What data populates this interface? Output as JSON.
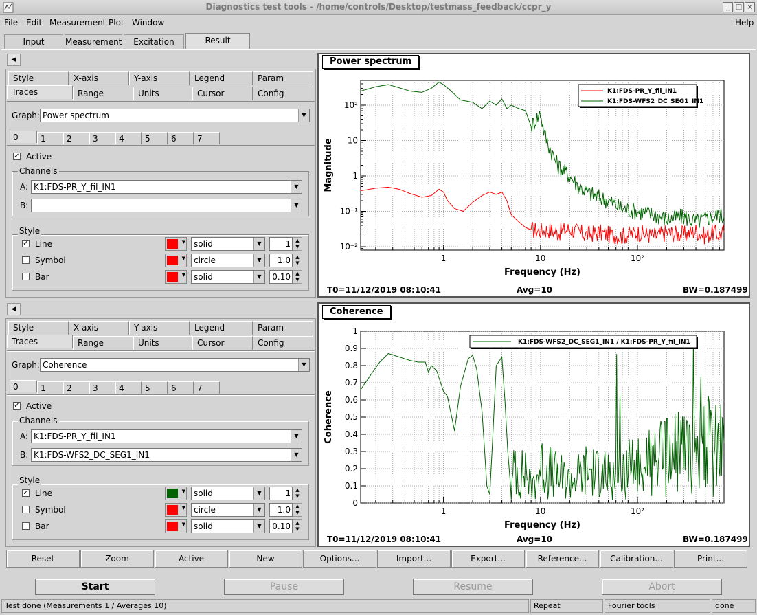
{
  "window": {
    "title": "Diagnostics test tools - /home/controls/Desktop/testmass_feedback/ccpr_y"
  },
  "menu": [
    "File",
    "Edit",
    "Measurement",
    "Plot",
    "Window"
  ],
  "menu_help": "Help",
  "main_tabs": [
    "Input",
    "Measurement",
    "Excitation",
    "Result"
  ],
  "panels": [
    {
      "subtabs_row1": [
        "Style",
        "X-axis",
        "Y-axis",
        "Legend",
        "Param"
      ],
      "subtabs_row2": [
        "Traces",
        "Range",
        "Units",
        "Cursor",
        "Config"
      ],
      "graph_label": "Graph:",
      "graph_value": "Power spectrum",
      "trace_tabs": [
        "0",
        "1",
        "2",
        "3",
        "4",
        "5",
        "6",
        "7"
      ],
      "active_label": "Active",
      "active_checked": "✓",
      "channels_label": "Channels",
      "channel_a_label": "A:",
      "channel_a": "K1:FDS-PR_Y_fil_IN1",
      "channel_b_label": "B:",
      "channel_b": "",
      "style_label": "Style",
      "style_rows": [
        {
          "label": "Line",
          "checked": "✓",
          "color": "#ff0000",
          "style": "solid",
          "value": "1"
        },
        {
          "label": "Symbol",
          "checked": "",
          "color": "#ff0000",
          "style": "circle",
          "value": "1.0"
        },
        {
          "label": "Bar",
          "checked": "",
          "color": "#ff0000",
          "style": "solid",
          "value": "0.10"
        }
      ]
    },
    {
      "subtabs_row1": [
        "Style",
        "X-axis",
        "Y-axis",
        "Legend",
        "Param"
      ],
      "subtabs_row2": [
        "Traces",
        "Range",
        "Units",
        "Cursor",
        "Config"
      ],
      "graph_label": "Graph:",
      "graph_value": "Coherence",
      "trace_tabs": [
        "0",
        "1",
        "2",
        "3",
        "4",
        "5",
        "6",
        "7"
      ],
      "active_label": "Active",
      "active_checked": "✓",
      "channels_label": "Channels",
      "channel_a_label": "A:",
      "channel_a": "K1:FDS-PR_Y_fil_IN1",
      "channel_b_label": "B:",
      "channel_b": "K1:FDS-WFS2_DC_SEG1_IN1",
      "style_label": "Style",
      "style_rows": [
        {
          "label": "Line",
          "checked": "✓",
          "color": "#006400",
          "style": "solid",
          "value": "1"
        },
        {
          "label": "Symbol",
          "checked": "",
          "color": "#ff0000",
          "style": "circle",
          "value": "1.0"
        },
        {
          "label": "Bar",
          "checked": "",
          "color": "#ff0000",
          "style": "solid",
          "value": "0.10"
        }
      ]
    }
  ],
  "plots": [
    {
      "title": "Power spectrum",
      "t0": "T0=11/12/2019 08:10:41",
      "avg": "Avg=10",
      "bw": "BW=0.187499"
    },
    {
      "title": "Coherence",
      "t0": "T0=11/12/2019 08:10:41",
      "avg": "Avg=10",
      "bw": "BW=0.187499"
    }
  ],
  "chart_data": [
    {
      "type": "line",
      "title": "Power spectrum",
      "xlabel": "Frequency (Hz)",
      "ylabel": "Magnitude",
      "xscale": "log",
      "yscale": "log",
      "xlim": [
        0.14,
        780
      ],
      "ylim": [
        0.008,
        500
      ],
      "grid": true,
      "legend": "top-right",
      "x_ticks": [
        "1",
        "10",
        "10²"
      ],
      "y_ticks": [
        "10⁻²",
        "10⁻¹",
        "1",
        "10",
        "10²"
      ],
      "series": [
        {
          "name": "K1:FDS-PR_Y_fil_IN1",
          "color": "#ff0000",
          "x": [
            0.14,
            0.2,
            0.27,
            0.35,
            0.45,
            0.6,
            0.75,
            0.9,
            1.0,
            1.1,
            1.3,
            1.6,
            2.0,
            2.5,
            3.0,
            3.5,
            4.0,
            4.5,
            5.0,
            6.0,
            7.0,
            8.0,
            10,
            12,
            15,
            20,
            25,
            30,
            40,
            50,
            70,
            100,
            150,
            200,
            300,
            400,
            500,
            600,
            700,
            780
          ],
          "y": [
            0.38,
            0.45,
            0.48,
            0.42,
            0.32,
            0.25,
            0.28,
            0.42,
            0.35,
            0.2,
            0.12,
            0.1,
            0.18,
            0.28,
            0.35,
            0.3,
            0.35,
            0.2,
            0.08,
            0.05,
            0.035,
            0.03,
            0.028,
            0.03,
            0.025,
            0.032,
            0.025,
            0.022,
            0.025,
            0.022,
            0.02,
            0.025,
            0.02,
            0.025,
            0.022,
            0.028,
            0.02,
            0.025,
            0.022,
            0.025
          ]
        },
        {
          "name": "K1:FDS-WFS2_DC_SEG1_IN1",
          "color": "#006400",
          "x": [
            0.14,
            0.2,
            0.27,
            0.35,
            0.45,
            0.6,
            0.75,
            0.9,
            1.0,
            1.2,
            1.5,
            2.0,
            2.5,
            3.0,
            3.5,
            4.0,
            4.5,
            5.0,
            6.0,
            7.0,
            8.0,
            9.0,
            10,
            11,
            12,
            15,
            20,
            25,
            30,
            40,
            50,
            70,
            100,
            150,
            200,
            300,
            400,
            500,
            600,
            700,
            780
          ],
          "y": [
            250,
            330,
            380,
            310,
            250,
            230,
            300,
            450,
            380,
            250,
            140,
            120,
            80,
            130,
            100,
            150,
            80,
            100,
            80,
            70,
            25,
            40,
            60,
            15,
            8,
            2,
            1.0,
            0.5,
            0.35,
            0.25,
            0.2,
            0.12,
            0.1,
            0.08,
            0.06,
            0.07,
            0.05,
            0.06,
            0.07,
            0.08,
            0.07
          ]
        }
      ]
    },
    {
      "type": "line",
      "title": "Coherence",
      "xlabel": "Frequency (Hz)",
      "ylabel": "Coherence",
      "xscale": "log",
      "xlim": [
        0.14,
        780
      ],
      "ylim": [
        0,
        1
      ],
      "grid": true,
      "legend": "top-right",
      "x_ticks": [
        "1",
        "10",
        "10²"
      ],
      "y_ticks": [
        "0",
        "0.1",
        "0.2",
        "0.3",
        "0.4",
        "0.5",
        "0.6",
        "0.7",
        "0.8",
        "0.9",
        "1"
      ],
      "series": [
        {
          "name": "K1:FDS-WFS2_DC_SEG1_IN1 / K1:FDS-PR_Y_fil_IN1",
          "color": "#006400",
          "x": [
            0.14,
            0.18,
            0.22,
            0.27,
            0.35,
            0.45,
            0.55,
            0.65,
            0.7,
            0.75,
            0.85,
            1.0,
            1.1,
            1.3,
            1.5,
            1.8,
            2.0,
            2.2,
            2.5,
            2.8,
            3.0,
            3.2,
            3.5,
            4.0,
            4.3,
            4.6,
            5.0,
            5.5,
            6.0,
            7.0,
            8.0,
            10,
            15,
            20,
            30,
            50,
            100,
            200,
            400,
            780
          ],
          "y": [
            0.66,
            0.75,
            0.82,
            0.87,
            0.85,
            0.83,
            0.82,
            0.82,
            0.76,
            0.8,
            0.77,
            0.65,
            0.62,
            0.42,
            0.68,
            0.84,
            0.86,
            0.78,
            0.53,
            0.1,
            0.05,
            0.35,
            0.8,
            0.85,
            0.6,
            0.3,
            0.05,
            0.25,
            0.12,
            0.2,
            0.08,
            0.2,
            0.15,
            0.12,
            0.18,
            0.15,
            0.2,
            0.25,
            0.3,
            0.35
          ]
        }
      ]
    }
  ],
  "bottom_buttons": [
    "Reset",
    "Zoom",
    "Active",
    "New",
    "Options...",
    "Import...",
    "Export...",
    "Reference...",
    "Calibration...",
    "Print..."
  ],
  "control_buttons": [
    "Start",
    "Pause",
    "Resume",
    "Abort"
  ],
  "status": {
    "message": "Test done (Measurements 1 / Averages 10)",
    "mode": "Repeat",
    "tool": "Fourier tools",
    "state": "done"
  }
}
